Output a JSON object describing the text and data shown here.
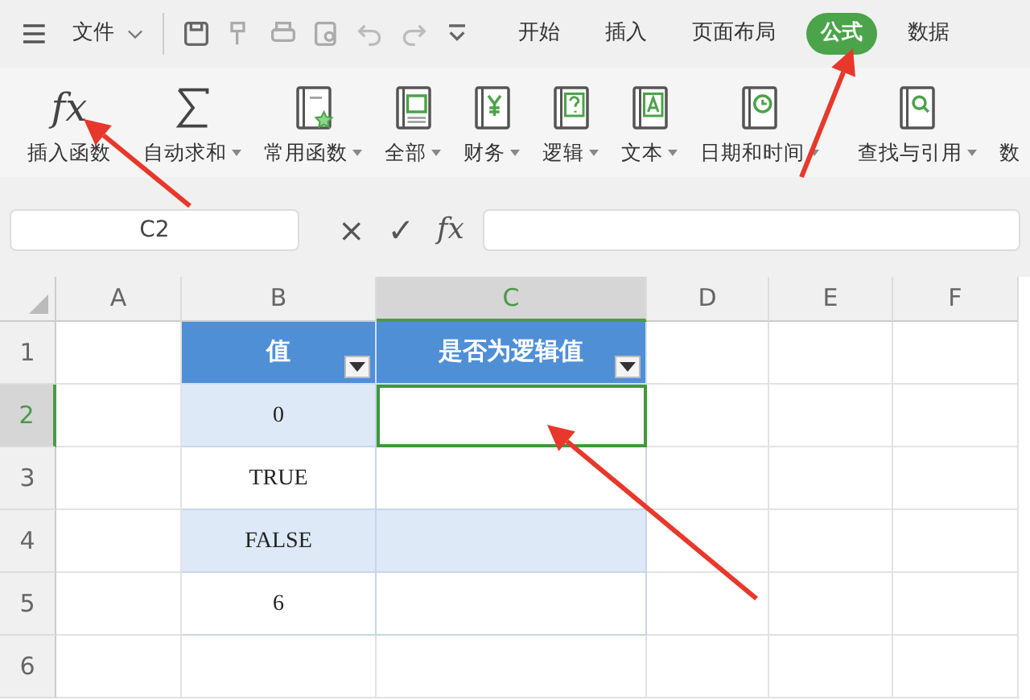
{
  "menu": {
    "label": "文件",
    "tabs": [
      {
        "label": "开始",
        "selected": false
      },
      {
        "label": "插入",
        "selected": false
      },
      {
        "label": "页面布局",
        "selected": false
      },
      {
        "label": "公式",
        "selected": true
      },
      {
        "label": "数据",
        "selected": false
      }
    ]
  },
  "quick_tools": [
    {
      "kind": "save"
    },
    {
      "kind": "painter"
    },
    {
      "kind": "print"
    },
    {
      "kind": "preview"
    },
    {
      "kind": "undo"
    },
    {
      "kind": "redo"
    },
    {
      "kind": "more"
    }
  ],
  "ribbon": [
    {
      "kind": "fx",
      "glyph": "fx",
      "label": "插入函数",
      "dropdown": false
    },
    {
      "kind": "sigma",
      "label": "自动求和",
      "dropdown": true
    },
    {
      "kind": "star",
      "label": "常用函数",
      "dropdown": true
    },
    {
      "kind": "all",
      "label": "全部",
      "dropdown": true
    },
    {
      "kind": "yen",
      "label": "财务",
      "dropdown": true
    },
    {
      "kind": "question",
      "label": "逻辑",
      "dropdown": true
    },
    {
      "kind": "letter",
      "label": "文本",
      "dropdown": true
    },
    {
      "kind": "clock",
      "label": "日期和时间",
      "dropdown": true
    },
    {
      "kind": "search",
      "label": "查找与引用",
      "dropdown": true
    },
    {
      "kind": "none",
      "label": "数",
      "dropdown": false
    }
  ],
  "formula_bar": {
    "name_box": "C2",
    "cancel": "×",
    "enter": "✓",
    "fx": "fx"
  },
  "columns": [
    {
      "label": "A",
      "selected": false
    },
    {
      "label": "B",
      "selected": false
    },
    {
      "label": "C",
      "selected": true
    },
    {
      "label": "D",
      "selected": false
    },
    {
      "label": "E",
      "selected": false
    },
    {
      "label": "F",
      "selected": false
    }
  ],
  "rows": [
    {
      "label": "1",
      "selected": false,
      "cells": [
        {
          "value": "值",
          "kind": "header",
          "selected": false
        },
        {
          "value": "是否为逻辑值",
          "kind": "header",
          "selected": false
        }
      ]
    },
    {
      "label": "2",
      "selected": true,
      "cells": [
        {
          "value": "0",
          "kind": "band",
          "selected": false
        },
        {
          "kind": "band",
          "selected": true
        }
      ]
    },
    {
      "label": "3",
      "selected": false,
      "cells": [
        {
          "value": "TRUE",
          "kind": "plain",
          "selected": false
        },
        {
          "kind": "plain",
          "selected": false
        }
      ]
    },
    {
      "label": "4",
      "selected": false,
      "cells": [
        {
          "value": "FALSE",
          "kind": "band",
          "selected": false
        },
        {
          "kind": "band",
          "selected": false
        }
      ]
    },
    {
      "label": "5",
      "selected": false,
      "cells": [
        {
          "value": "6",
          "kind": "plain",
          "selected": false
        },
        {
          "kind": "plain",
          "selected": false
        }
      ]
    },
    {
      "label": "6",
      "selected": false,
      "cells": [
        {
          "kind": "none",
          "selected": false
        },
        {
          "kind": "none",
          "selected": false
        }
      ]
    }
  ],
  "annotations": [
    {
      "kind": "arrow"
    },
    {
      "kind": "arrow"
    },
    {
      "kind": "arrow"
    }
  ]
}
